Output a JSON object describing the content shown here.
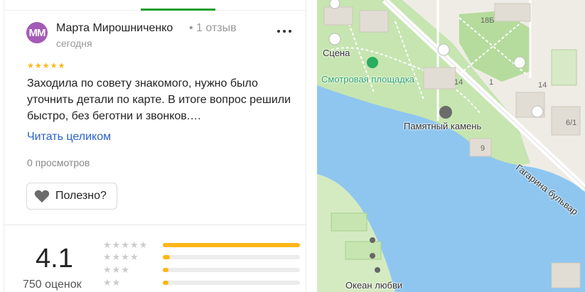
{
  "review": {
    "avatar_initials": "MM",
    "author": "Марта Мирошниченко",
    "reviews_count": "• 1 отзыв",
    "date": "сегодня",
    "stars": 5,
    "text": "Заходила по совету знакомого, нужно было уточнить детали по карте. В итоге вопрос решили быстро, без беготни и звонков.…",
    "read_more": "Читать целиком",
    "views": "0 просмотров",
    "useful_label": "Полезно?"
  },
  "rating": {
    "value": "4.1",
    "count_label": "750 оценок",
    "distribution": [
      {
        "stars": 5,
        "fraction": 1.0
      },
      {
        "stars": 4,
        "fraction": 0.05
      },
      {
        "stars": 3,
        "fraction": 0.04
      },
      {
        "stars": 2,
        "fraction": 0.04
      }
    ]
  },
  "map": {
    "labels": {
      "scene": "Сцена",
      "viewpoint": "Смотровая площадка",
      "memorial_stone": "Памятный камень",
      "boulevard": "Гагарина бульвар",
      "ocean": "Океан любви"
    },
    "numbers": {
      "n18b": "18Б",
      "n14a": "14",
      "n1": "1",
      "n14b": "14",
      "n9": "9",
      "n61": "6/1"
    }
  },
  "colors": {
    "accent_green": "#1a9e2c",
    "star": "#fcb717",
    "link": "#2a62c9",
    "avatar": "#a35ab7",
    "water": "#8fc6f0",
    "park": "#c6e5b0"
  }
}
